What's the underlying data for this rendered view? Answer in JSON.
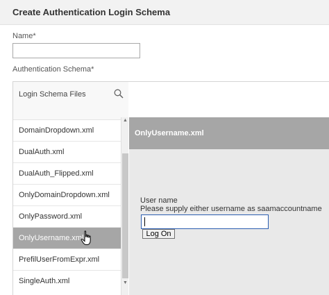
{
  "dialog": {
    "title": "Create Authentication Login Schema"
  },
  "form": {
    "name_label": "Name*",
    "name_value": "",
    "schema_label": "Authentication Schema*"
  },
  "file_list": {
    "title": "Login Schema Files",
    "items": [
      {
        "label": "DomainDropdown.xml",
        "selected": false
      },
      {
        "label": "DualAuth.xml",
        "selected": false
      },
      {
        "label": "DualAuth_Flipped.xml",
        "selected": false
      },
      {
        "label": "OnlyDomainDropdown.xml",
        "selected": false
      },
      {
        "label": "OnlyPassword.xml",
        "selected": false
      },
      {
        "label": "OnlyUsername.xml",
        "selected": true
      },
      {
        "label": "PrefilUserFromExpr.xml",
        "selected": false
      },
      {
        "label": "SingleAuth.xml",
        "selected": false
      }
    ]
  },
  "preview": {
    "title": "OnlyUsername.xml",
    "username_label": "User name",
    "hint": "Please supply either username as saamaccountname",
    "input_value": "",
    "logon_label": "Log On"
  },
  "icons": {
    "search": "search-icon",
    "cursor": "hand-pointer-icon",
    "scroll_up": "scroll-up-arrow-icon",
    "scroll_down": "scroll-down-arrow-icon"
  },
  "colors": {
    "header_bg": "#f2f2f2",
    "selected_bg": "#a6a6a6",
    "preview_bg": "#e9e9e9",
    "input_focus_border": "#2a5db0"
  }
}
